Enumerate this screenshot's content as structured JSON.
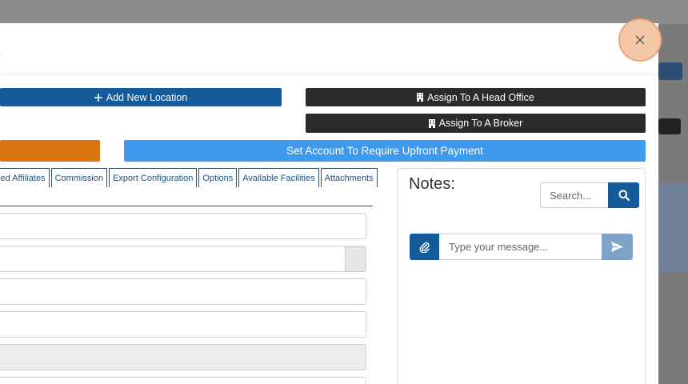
{
  "modal": {
    "title": "."
  },
  "actions": {
    "add_location": "Add New Location",
    "assign_head_office": "Assign To A Head Office",
    "assign_broker": "Assign To A Broker",
    "orange_label": "",
    "upfront_payment": "Set Account To Require Upfront Payment"
  },
  "tabs": [
    {
      "label": "ked Affiliates"
    },
    {
      "label": "Commission"
    },
    {
      "label": "Export Configuration"
    },
    {
      "label": "Options"
    },
    {
      "label": "Available Facilities"
    },
    {
      "label": "Attachments"
    }
  ],
  "notes": {
    "title": "Notes:",
    "search_placeholder": "Search...",
    "message_placeholder": "Type your message..."
  },
  "colors": {
    "primary": "#155a99",
    "dark": "#2b2b2b",
    "orange": "#d9730d",
    "light_blue": "#3d9aec"
  },
  "icons": {
    "add": "plus-icon",
    "building": "building-icon",
    "search": "search-icon",
    "attach": "paperclip-icon",
    "send": "send-icon",
    "close": "close-icon"
  }
}
